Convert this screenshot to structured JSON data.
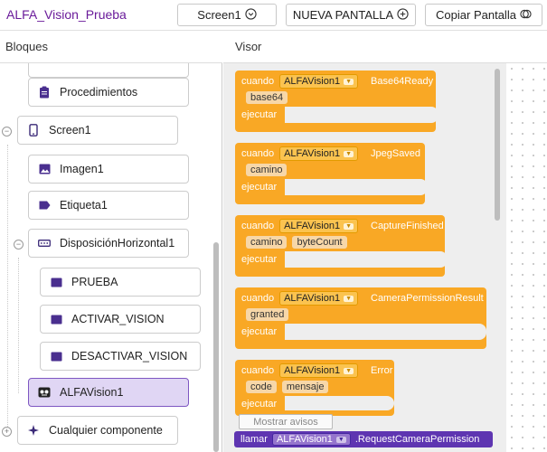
{
  "project": {
    "title": "ALFA_Vision_Prueba"
  },
  "toolbar": {
    "screen_select": "Screen1",
    "new_screen": "NUEVA PANTALLA",
    "copy_screen": "Copiar Pantalla"
  },
  "left_panel": {
    "title": "Bloques",
    "items": [
      {
        "label": "Procedimientos"
      },
      {
        "label": "Screen1"
      },
      {
        "label": "Imagen1"
      },
      {
        "label": "Etiqueta1"
      },
      {
        "label": "DisposiciónHorizontal1"
      },
      {
        "label": "PRUEBA"
      },
      {
        "label": "ACTIVAR_VISION"
      },
      {
        "label": "DESACTIVAR_VISION"
      },
      {
        "label": "ALFAVision1"
      },
      {
        "label": "Cualquier componente"
      }
    ]
  },
  "workspace": {
    "title": "Visor",
    "when_label": "cuando",
    "do_label": "ejecutar",
    "component": "ALFAVision1",
    "events": [
      {
        "name": "Base64Ready",
        "params": [
          "base64"
        ]
      },
      {
        "name": "JpegSaved",
        "params": [
          "camino"
        ]
      },
      {
        "name": "CaptureFinished",
        "params": [
          "camino",
          "byteCount"
        ]
      },
      {
        "name": "CameraPermissionResult",
        "params": [
          "granted"
        ]
      },
      {
        "name": "Error",
        "params": [
          "code",
          "mensaje"
        ]
      }
    ],
    "show_warnings": "Mostrar avisos",
    "call_block": {
      "call_label": "llamar",
      "component": "ALFAVision1",
      "method": ".RequestCameraPermission"
    }
  },
  "colors": {
    "event_block": "#f9a825",
    "call_block": "#5e35b1",
    "accent": "#6a1b9a"
  }
}
